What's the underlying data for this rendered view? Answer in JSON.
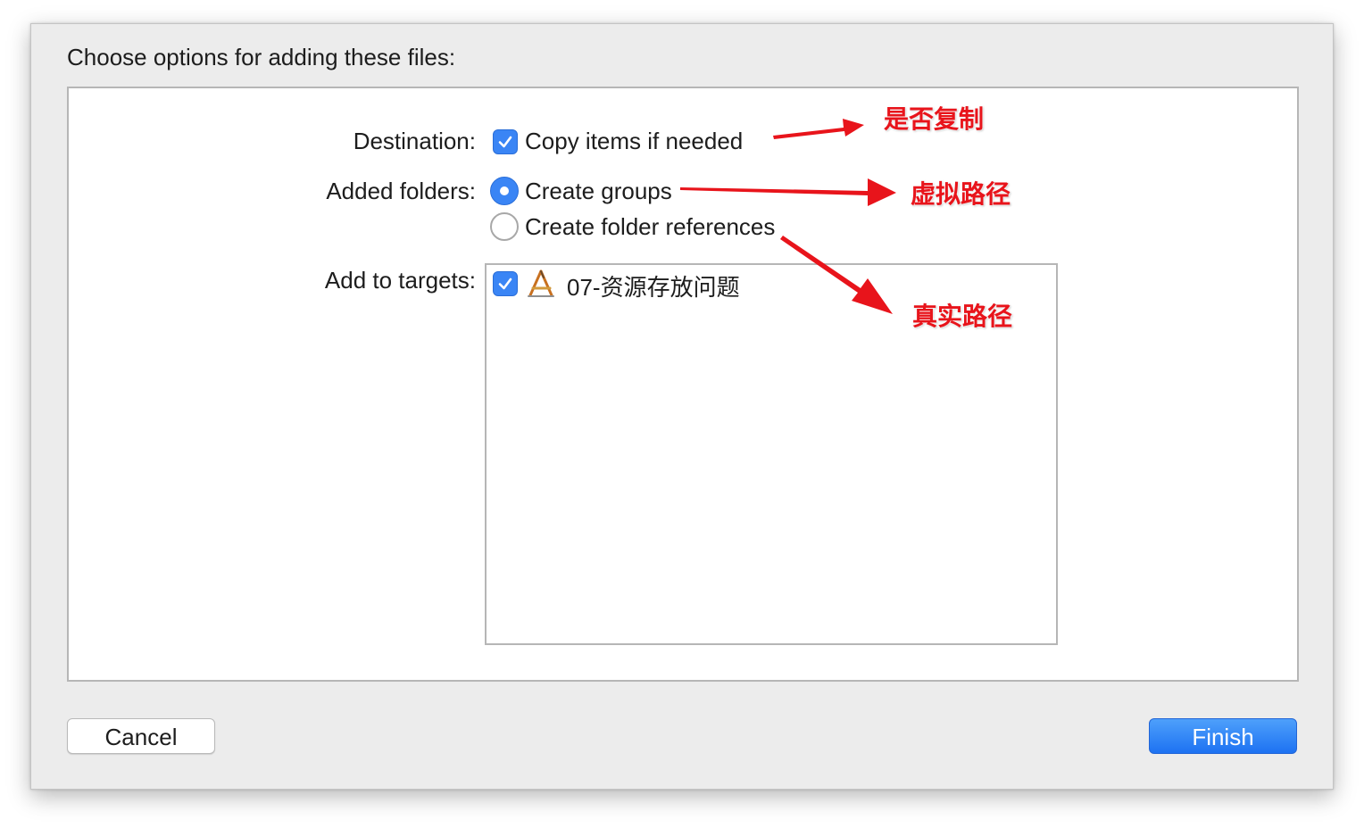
{
  "dialog": {
    "title": "Choose options for adding these files:",
    "destination": {
      "label": "Destination:",
      "checkbox_label": "Copy items if needed",
      "checked": true
    },
    "added_folders": {
      "label": "Added folders:",
      "options": [
        {
          "label": "Create groups",
          "selected": true
        },
        {
          "label": "Create folder references",
          "selected": false
        }
      ]
    },
    "add_to_targets": {
      "label": "Add to targets:",
      "targets": [
        {
          "name": "07-资源存放问题",
          "checked": true,
          "icon": "xcode-app-icon"
        }
      ]
    },
    "buttons": {
      "cancel": "Cancel",
      "finish": "Finish"
    }
  },
  "annotations": {
    "copy": "是否复制",
    "groups": "虚拟路径",
    "references": "真实路径",
    "color": "#e8141b"
  },
  "colors": {
    "accent": "#3a85f5",
    "finish_button": "#1d72f2"
  }
}
